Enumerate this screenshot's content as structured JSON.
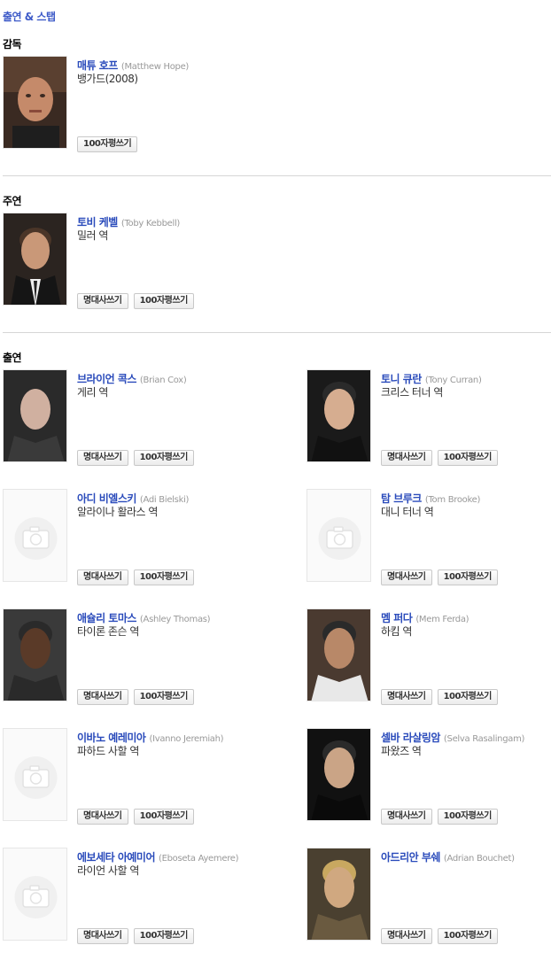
{
  "page_title": "출연 & 스탭",
  "sections": {
    "director": "감독",
    "lead": "주연",
    "cast": "출연"
  },
  "buttons": {
    "quote": "명대사쓰기",
    "review": "100자평쓰기"
  },
  "director": {
    "name_ko": "매튜 호프",
    "name_en": "(Matthew Hope)",
    "role": "뱅가드(2008)"
  },
  "lead": {
    "name_ko": "토비 케벨",
    "name_en": "(Toby Kebbell)",
    "role": "밀러 역"
  },
  "cast": [
    {
      "name_ko": "브라이언 콕스",
      "name_en": "(Brian Cox)",
      "role": "게리 역",
      "photo": "person"
    },
    {
      "name_ko": "토니 큐란",
      "name_en": "(Tony Curran)",
      "role": "크리스 터너 역",
      "photo": "person"
    },
    {
      "name_ko": "아디 비엘스키",
      "name_en": "(Adi Bielski)",
      "role": "알라이나 활라스 역",
      "photo": "placeholder"
    },
    {
      "name_ko": "탐 브루크",
      "name_en": "(Tom Brooke)",
      "role": "대니 터너 역",
      "photo": "placeholder"
    },
    {
      "name_ko": "애슐리 토마스",
      "name_en": "(Ashley Thomas)",
      "role": "타이론 존슨 역",
      "photo": "person"
    },
    {
      "name_ko": "멤 퍼다",
      "name_en": "(Mem Ferda)",
      "role": "하킴 역",
      "photo": "person"
    },
    {
      "name_ko": "이바노 예레미아",
      "name_en": "(Ivanno Jeremiah)",
      "role": "파하드 사할 역",
      "photo": "placeholder"
    },
    {
      "name_ko": "셀바 라살링암",
      "name_en": "(Selva Rasalingam)",
      "role": "파왔즈 역",
      "photo": "person"
    },
    {
      "name_ko": "에보세타 아예미어",
      "name_en": "(Eboseta Ayemere)",
      "role": "라이언 사할 역",
      "photo": "placeholder"
    },
    {
      "name_ko": "아드리안 부쉐",
      "name_en": "(Adrian Bouchet)",
      "role": "",
      "photo": "person"
    }
  ],
  "icons": {
    "placeholder_photo": "camera-icon",
    "person_photo": "person-photo"
  },
  "colors": {
    "title": "#3d5ac8",
    "link": "#2a4bbb",
    "divider": "#d6d6d6"
  }
}
